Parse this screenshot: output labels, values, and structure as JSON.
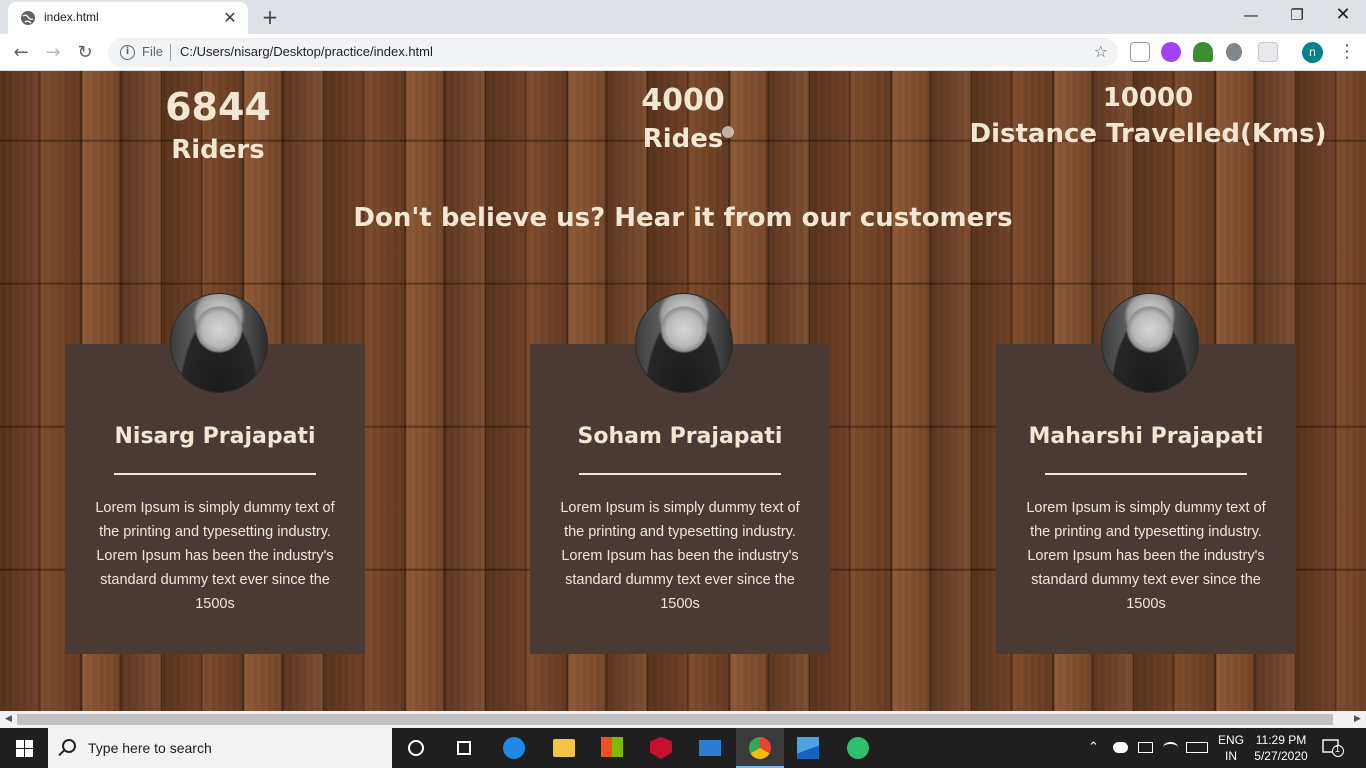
{
  "browser": {
    "tab_title": "index.html",
    "tab_close_glyph": "✕",
    "new_tab_glyph": "+",
    "scheme_label": "File",
    "url": "C:/Users/nisarg/Desktop/practice/index.html",
    "profile_initial": "n",
    "window_controls": {
      "minimize": "—",
      "maximize": "❐",
      "close": "✕"
    }
  },
  "stats": [
    {
      "number": "6844",
      "label": "Riders"
    },
    {
      "number": "4000",
      "label": "Rides"
    },
    {
      "number": "10000",
      "label": "Distance Travelled(Kms)"
    }
  ],
  "headline": "Don't believe us? Hear it from our customers",
  "testimonials": [
    {
      "name": "Nisarg Prajapati",
      "text": "Lorem Ipsum is simply dummy text of the printing and typesetting industry. Lorem Ipsum has been the industry's standard dummy text ever since the 1500s"
    },
    {
      "name": "Soham Prajapati",
      "text": "Lorem Ipsum is simply dummy text of the printing and typesetting industry. Lorem Ipsum has been the industry's standard dummy text ever since the 1500s"
    },
    {
      "name": "Maharshi Prajapati",
      "text": "Lorem Ipsum is simply dummy text of the printing and typesetting industry. Lorem Ipsum has been the industry's standard dummy text ever since the 1500s"
    }
  ],
  "taskbar": {
    "search_placeholder": "Type here to search",
    "language": "ENG",
    "region": "IN",
    "time": "11:29 PM",
    "date": "5/27/2020",
    "notification_count": "1"
  },
  "colors": {
    "card_bg": "#4a3a36",
    "text_cream": "#f3e6d3",
    "profile_teal": "#00838f"
  }
}
